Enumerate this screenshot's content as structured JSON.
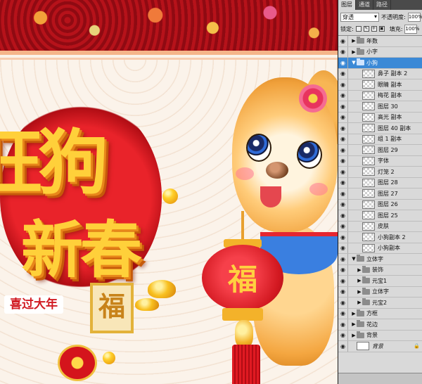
{
  "canvas": {
    "title_chars": [
      "旺狗",
      "新春"
    ],
    "subtitle": "喜过大年",
    "seal_char": "福",
    "lantern_char": "福",
    "colors": {
      "title_gold": "#ffd03a",
      "festive_red": "#d4141c",
      "cream_bg": "#fbf3ea"
    }
  },
  "panel": {
    "tabs": [
      "图层",
      "通道",
      "路径"
    ],
    "blend_mode": "穿透",
    "opacity_label": "不透明度:",
    "opacity_value": "100%",
    "lock_label": "锁定:",
    "fill_label": "填充:",
    "fill_value": "100%",
    "layers": [
      {
        "name": "年数",
        "kind": "group",
        "indent": 0,
        "expanded": false
      },
      {
        "name": "小字",
        "kind": "group",
        "indent": 0,
        "expanded": false
      },
      {
        "name": "小狗",
        "kind": "group",
        "indent": 0,
        "expanded": true,
        "selected": true
      },
      {
        "name": "鼻子 副本 2",
        "kind": "layer",
        "indent": 1
      },
      {
        "name": "眼睛 副本",
        "kind": "layer",
        "indent": 1
      },
      {
        "name": "梅花 副本",
        "kind": "layer",
        "indent": 1
      },
      {
        "name": "图层 30",
        "kind": "layer",
        "indent": 1
      },
      {
        "name": "高光 副本",
        "kind": "layer",
        "indent": 1
      },
      {
        "name": "图层 40 副本",
        "kind": "layer",
        "indent": 1
      },
      {
        "name": "组 1 副本",
        "kind": "layer",
        "indent": 1
      },
      {
        "name": "图层 29",
        "kind": "layer",
        "indent": 1
      },
      {
        "name": "字体",
        "kind": "layer",
        "indent": 1
      },
      {
        "name": "灯笼 2",
        "kind": "layer",
        "indent": 1
      },
      {
        "name": "图层 28",
        "kind": "layer",
        "indent": 1
      },
      {
        "name": "图层 27",
        "kind": "layer",
        "indent": 1
      },
      {
        "name": "图层 26",
        "kind": "layer",
        "indent": 1
      },
      {
        "name": "图层 25",
        "kind": "layer",
        "indent": 1
      },
      {
        "name": "皮肤",
        "kind": "layer",
        "indent": 1
      },
      {
        "name": "小狗副本 2",
        "kind": "layer",
        "indent": 1
      },
      {
        "name": "小狗副本",
        "kind": "layer",
        "indent": 1
      },
      {
        "name": "立体字",
        "kind": "group",
        "indent": 0,
        "expanded": true
      },
      {
        "name": "装饰",
        "kind": "group",
        "indent": 1,
        "expanded": false
      },
      {
        "name": "元宝1",
        "kind": "group",
        "indent": 1,
        "expanded": false
      },
      {
        "name": "立体字",
        "kind": "group",
        "indent": 1,
        "expanded": false
      },
      {
        "name": "元宝2",
        "kind": "group",
        "indent": 1,
        "expanded": false
      },
      {
        "name": "方框",
        "kind": "group",
        "indent": 0,
        "expanded": false
      },
      {
        "name": "花边",
        "kind": "group",
        "indent": 0,
        "expanded": false
      },
      {
        "name": "背景",
        "kind": "group",
        "indent": 0,
        "expanded": false
      },
      {
        "name": "背景",
        "kind": "background",
        "indent": 0,
        "locked": true
      }
    ]
  }
}
